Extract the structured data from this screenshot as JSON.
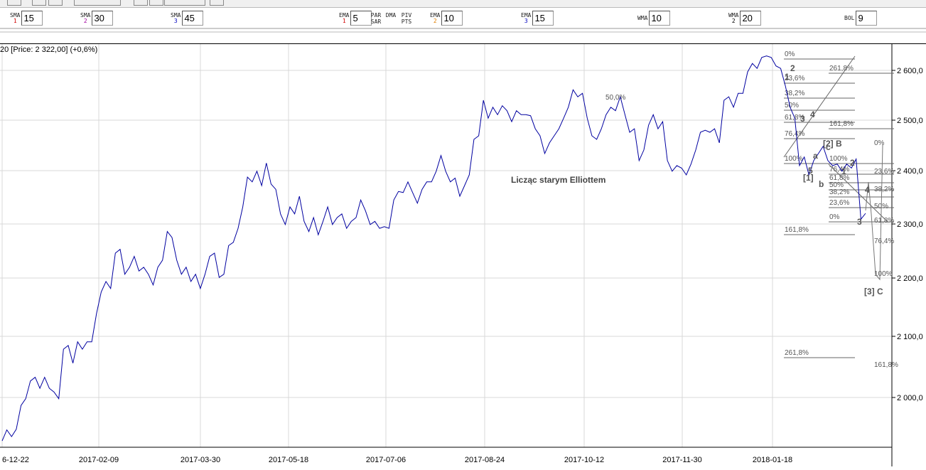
{
  "toolbar": {
    "indicators": [
      {
        "name": "SMA",
        "num": "1",
        "numColor": "#d00000",
        "value": "15"
      },
      {
        "name": "SMA",
        "num": "2",
        "numColor": "#a000a0",
        "value": "30"
      },
      {
        "name": "SMA",
        "num": "3",
        "numColor": "#0000c0",
        "value": "45"
      },
      {
        "name": "EMA",
        "num": "1",
        "numColor": "#d00000",
        "value": "5"
      },
      {
        "name": "EMA",
        "num": "2",
        "numColor": "#e08000",
        "value": "10"
      },
      {
        "name": "EMA",
        "num": "3",
        "numColor": "#0000c0",
        "value": "15"
      },
      {
        "name": "WMA",
        "num": "",
        "numColor": "#000",
        "value": "10"
      },
      {
        "name": "WMA",
        "num": "2",
        "numColor": "#000",
        "value": "20"
      },
      {
        "name": "BOL",
        "num": "",
        "numColor": "#000",
        "value": "9"
      }
    ],
    "parsar": "PAR SAR",
    "dma": "DMA",
    "pivpts": "PIV PTS"
  },
  "chart": {
    "header": "20 [Price: 2 322,00] (+0,6%)",
    "annotation": "Licząc starym  Elliottem",
    "overlap_label": "50,0%",
    "line_color": "#0000a0",
    "y_ticks": [
      {
        "v": 2600,
        "label": "2 600,0"
      },
      {
        "v": 2500,
        "label": "2 500,0"
      },
      {
        "v": 2400,
        "label": "2 400,0"
      },
      {
        "v": 2300,
        "label": "2 300,0"
      },
      {
        "v": 2200,
        "label": "2 200,0"
      },
      {
        "v": 2100,
        "label": "2 100,0"
      },
      {
        "v": 2000,
        "label": "2 000,0"
      }
    ],
    "x_ticks": [
      "6-12-22",
      "2017-02-09",
      "2017-03-30",
      "2017-05-18",
      "2017-07-06",
      "2017-08-24",
      "2017-10-12",
      "2017-11-30",
      "2018-01-18"
    ],
    "prices": [
      1929,
      1947,
      1936,
      1948,
      1987,
      1998,
      2027,
      2033,
      2015,
      2033,
      2015,
      2009,
      1998,
      2079,
      2085,
      2056,
      2091,
      2079,
      2091,
      2091,
      2139,
      2176,
      2194,
      2182,
      2246,
      2253,
      2207,
      2220,
      2240,
      2213,
      2220,
      2207,
      2188,
      2220,
      2233,
      2286,
      2275,
      2233,
      2207,
      2220,
      2194,
      2207,
      2182,
      2207,
      2240,
      2246,
      2201,
      2207,
      2260,
      2266,
      2292,
      2332,
      2388,
      2379,
      2399,
      2372,
      2415,
      2375,
      2365,
      2319,
      2299,
      2332,
      2319,
      2352,
      2305,
      2286,
      2312,
      2280,
      2305,
      2332,
      2299,
      2312,
      2319,
      2292,
      2305,
      2312,
      2345,
      2325,
      2299,
      2305,
      2292,
      2295,
      2292,
      2345,
      2361,
      2359,
      2379,
      2359,
      2339,
      2365,
      2379,
      2379,
      2399,
      2430,
      2399,
      2379,
      2386,
      2352,
      2372,
      2392,
      2462,
      2469,
      2540,
      2504,
      2526,
      2511,
      2529,
      2519,
      2497,
      2519,
      2511,
      2511,
      2509,
      2483,
      2469,
      2434,
      2455,
      2469,
      2483,
      2504,
      2526,
      2561,
      2547,
      2554,
      2504,
      2469,
      2462,
      2483,
      2511,
      2526,
      2519,
      2547,
      2511,
      2476,
      2483,
      2420,
      2441,
      2490,
      2511,
      2483,
      2497,
      2420,
      2399,
      2410,
      2405,
      2392,
      2413,
      2441,
      2476,
      2480,
      2476,
      2483,
      2455,
      2540,
      2547,
      2526,
      2554,
      2554,
      2597,
      2614,
      2604,
      2626,
      2629,
      2626,
      2609,
      2604,
      2569,
      2526,
      2504,
      2410,
      2427,
      2392,
      2420,
      2434,
      2448,
      2420,
      2410,
      2413,
      2399,
      2413,
      2405,
      2423,
      2309,
      2320
    ],
    "fib_labels": [
      "0%",
      "23,6%",
      "38,2%",
      "50%",
      "61,8%",
      "76,4%",
      "100%",
      "161,8%",
      "261,8%",
      "161,8%",
      "261,8%",
      "100%",
      "76,4%",
      "61,8%",
      "50%",
      "38,2%",
      "23,6%",
      "0%",
      "0%",
      "23,6%",
      "38,2%",
      "50%",
      "61,8%",
      "76,4%",
      "100%",
      "161,8%"
    ],
    "wave_labels": [
      "1",
      "2",
      "3",
      "4",
      "5",
      "[1]",
      "a",
      "b",
      "c",
      "[2] B",
      "1",
      "2",
      "3",
      "4",
      "[3] C"
    ]
  }
}
